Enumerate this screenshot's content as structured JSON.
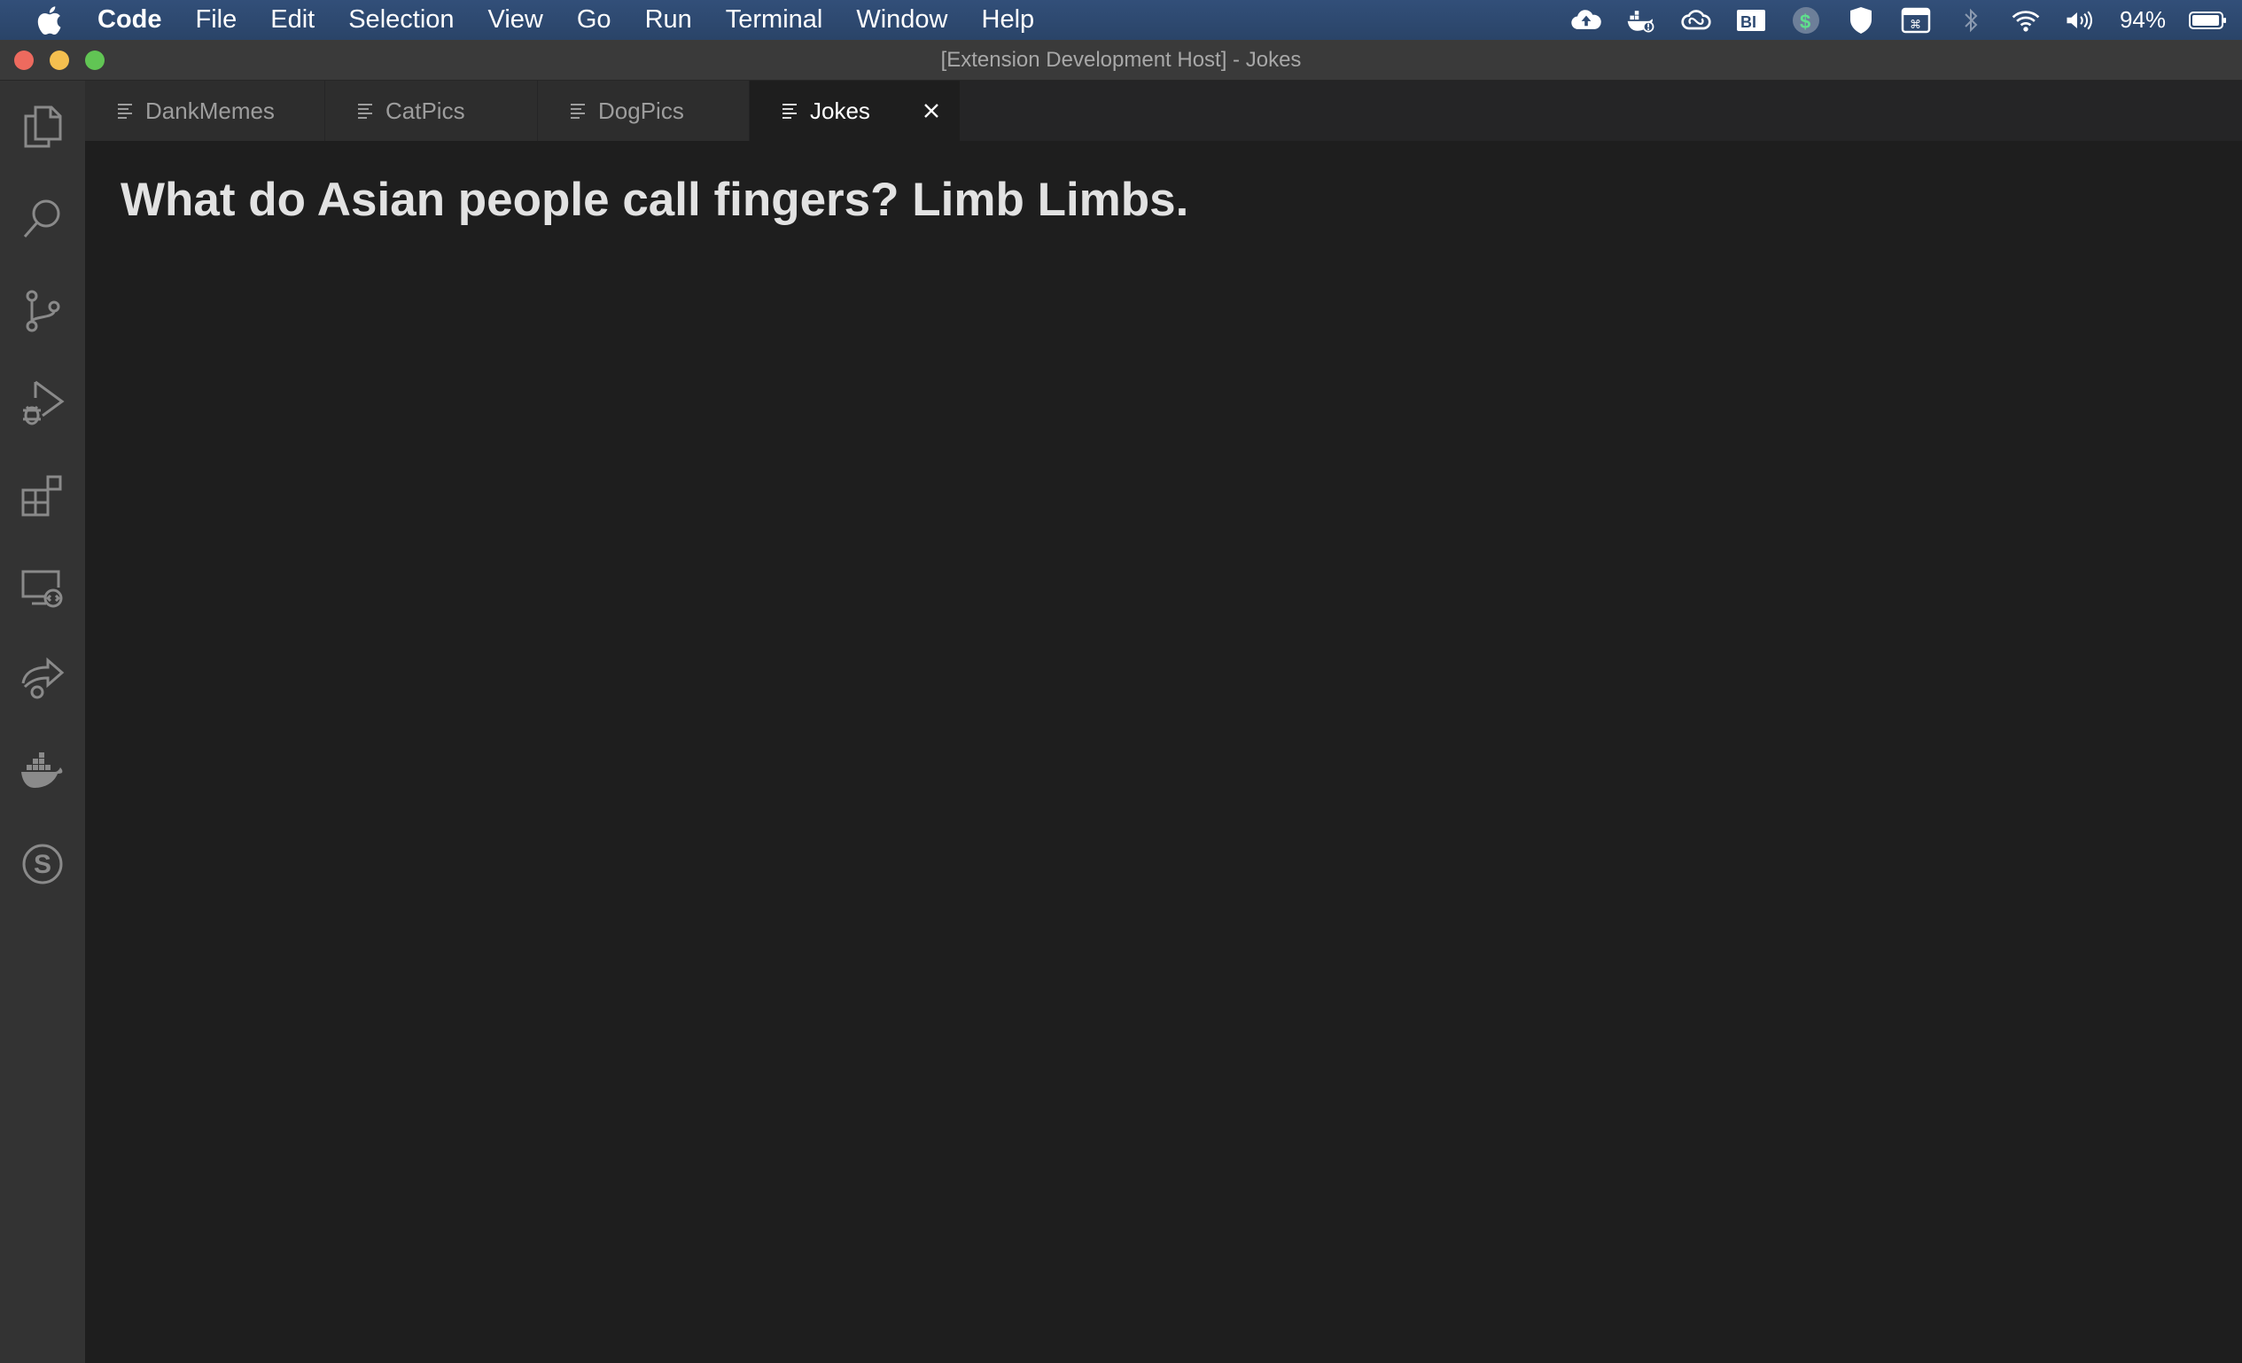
{
  "menubar": {
    "app_name": "Code",
    "items": [
      "File",
      "Edit",
      "Selection",
      "View",
      "Go",
      "Run",
      "Terminal",
      "Window",
      "Help"
    ],
    "status_icons": [
      "cloud-upload-icon",
      "docker-icon",
      "creative-cloud-icon",
      "bi-icon",
      "dollar-icon",
      "shield-icon",
      "keyboard-icon",
      "bluetooth-icon",
      "wifi-icon",
      "volume-icon"
    ],
    "battery": "94%"
  },
  "window": {
    "title": "[Extension Development Host] - Jokes"
  },
  "activitybar": {
    "items": [
      "explorer-icon",
      "search-icon",
      "source-control-icon",
      "run-debug-icon",
      "extensions-icon",
      "remote-explorer-icon",
      "live-share-icon",
      "docker-icon",
      "sourcegraph-icon"
    ]
  },
  "tabs": [
    {
      "label": "DankMemes",
      "active": false
    },
    {
      "label": "CatPics",
      "active": false
    },
    {
      "label": "DogPics",
      "active": false
    },
    {
      "label": "Jokes",
      "active": true
    }
  ],
  "editor": {
    "joke": "What do Asian people call fingers? Limb Limbs."
  }
}
